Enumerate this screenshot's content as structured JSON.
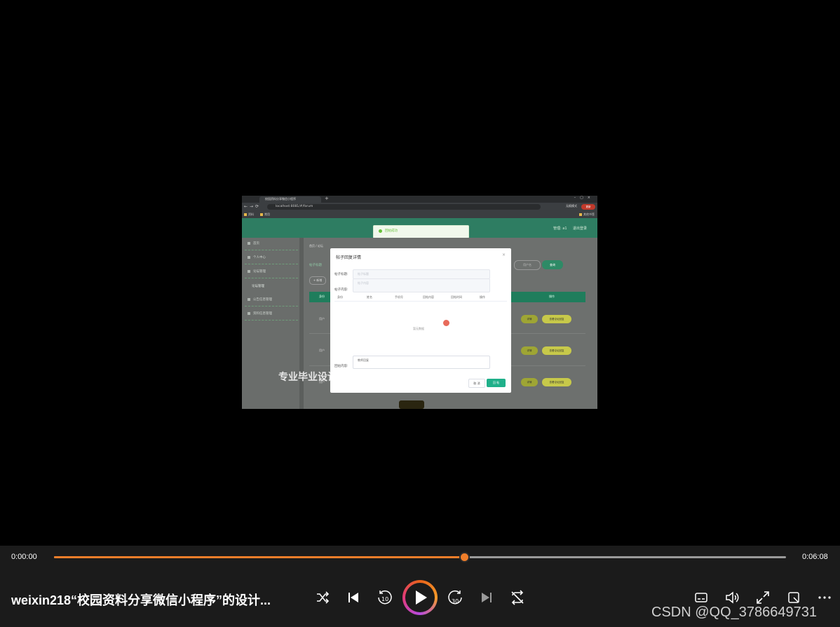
{
  "video_frame": {
    "browser": {
      "tab_title": "校园资料分享微信小程序",
      "url": "localhost:8081/#/forum",
      "incognito_label": "无痕模式",
      "update_label": "更新",
      "bookmarks": [
        "资料",
        "常用"
      ],
      "bookmark_right": "其他书签"
    },
    "app": {
      "header_user": "管理: a1",
      "header_logout": "退出登录",
      "toast": "回帖成功",
      "sidebar": {
        "items": [
          "首页",
          "个人中心",
          "论坛管理",
          "公告信息管理",
          "资料信息管理"
        ],
        "sub_item": "论坛管理"
      },
      "breadcrumb": "首页 / 论坛",
      "filter_label": "帖子标题",
      "add_button": "+ 新增",
      "search_placeholder": "用户名",
      "search_button": "查询",
      "table": {
        "first_header": "身份",
        "op_header": "操作",
        "rows": [
          {
            "type": "用户",
            "detail": "详情",
            "manage": "查看论坛回复"
          },
          {
            "type": "用户",
            "detail": "详情",
            "manage": "查看论坛回复"
          },
          {
            "type": "用户",
            "detail": "详情",
            "manage": "查看论坛回复"
          }
        ]
      }
    },
    "overlay_text": "专业毕业设计代做",
    "modal": {
      "title": "帖子回复详情",
      "close": "×",
      "post_title_label": "帖子标题:",
      "post_title_placeholder": "帖子标题",
      "post_content_label": "帖子内容:",
      "post_content_placeholder": "帖子内容",
      "columns": [
        "身份",
        "姓名",
        "手机号",
        "回帖内容",
        "回帖时间",
        "操作"
      ],
      "empty_text": "暂无数据",
      "reply_label": "回帖内容:",
      "reply_value": "教师回复",
      "cancel": "取 消",
      "submit": "回 帖"
    }
  },
  "player": {
    "current_time": "0:00:00",
    "total_time": "0:06:08",
    "progress": 0.56,
    "title": "weixin218“校园资料分享微信小程序”的设计...",
    "skip_back_label": "10",
    "skip_forward_label": "30",
    "accent_color": "#f07e2a",
    "icons": [
      "shuffle-icon",
      "previous-icon",
      "rewind-10-icon",
      "play-icon",
      "forward-30-icon",
      "next-icon",
      "repeat-icon",
      "subtitles-icon",
      "volume-icon",
      "fullscreen-icon",
      "miniplayer-icon",
      "more-icon"
    ]
  },
  "watermark": "CSDN @QQ_3786649731"
}
